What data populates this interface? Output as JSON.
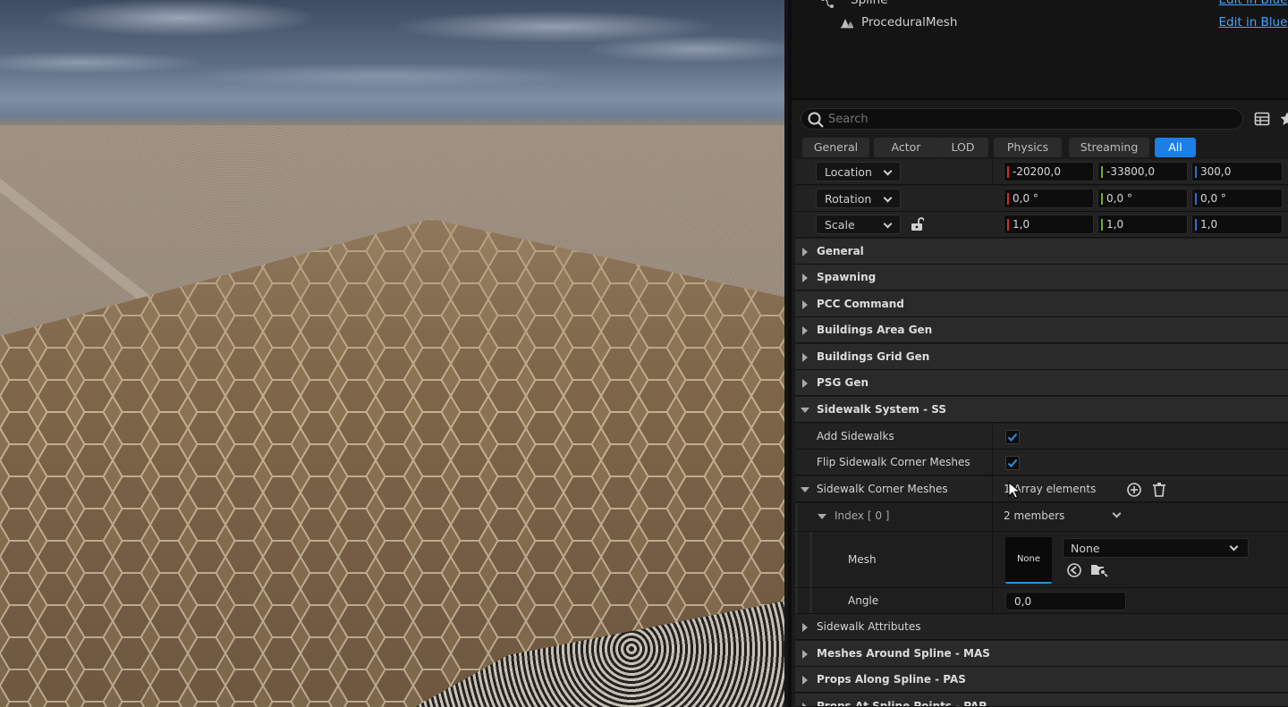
{
  "outliner": {
    "rows": [
      {
        "name": "Spline",
        "link": "Edit in Bluep"
      },
      {
        "name": "ProceduralMesh",
        "link": "Edit in Bluep"
      }
    ]
  },
  "search": {
    "placeholder": "Search"
  },
  "filters": [
    "General",
    "Actor",
    "LOD",
    "Physics",
    "Streaming",
    "All"
  ],
  "active_filter": "All",
  "transform": {
    "location": {
      "label": "Location",
      "x": "-20200,0",
      "y": "-33800,0",
      "z": "300,0"
    },
    "rotation": {
      "label": "Rotation",
      "x": "0,0 °",
      "y": "0,0 °",
      "z": "0,0 °"
    },
    "scale": {
      "label": "Scale",
      "x": "1,0",
      "y": "1,0",
      "z": "1,0"
    }
  },
  "axis_colors": {
    "x": "#c8341f",
    "y": "#7aa82a",
    "z": "#2f6fd0"
  },
  "accent_color": "#1b7fe6",
  "categories_top": [
    "General",
    "Spawning",
    "PCC Command",
    "Buildings Area Gen",
    "Buildings Grid Gen",
    "PSG Gen"
  ],
  "sidewalk": {
    "title": "Sidewalk System - SS",
    "add_sidewalks": {
      "label": "Add Sidewalks",
      "checked": true
    },
    "flip_corner": {
      "label": "Flip Sidewalk Corner Meshes",
      "checked": true
    },
    "corner_meshes": {
      "label": "Sidewalk Corner Meshes",
      "value": "1 Array elements"
    },
    "index0": {
      "label": "Index [ 0 ]",
      "value": "2 members"
    },
    "mesh": {
      "label": "Mesh",
      "thumb": "None",
      "value": "None"
    },
    "angle": {
      "label": "Angle",
      "value": "0,0"
    },
    "attributes": {
      "label": "Sidewalk Attributes"
    }
  },
  "categories_bottom": [
    "Meshes Around Spline - MAS",
    "Props Along Spline - PAS",
    "Props At Spline Points - PAP"
  ]
}
